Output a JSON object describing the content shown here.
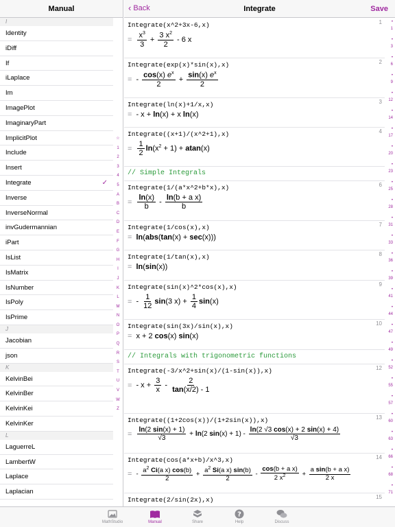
{
  "left": {
    "title": "Manual",
    "rows": [
      {
        "type": "section",
        "label": "I"
      },
      {
        "type": "item",
        "label": "Identity"
      },
      {
        "type": "item",
        "label": "iDiff"
      },
      {
        "type": "item",
        "label": "If"
      },
      {
        "type": "item",
        "label": "iLaplace"
      },
      {
        "type": "item",
        "label": "Im"
      },
      {
        "type": "item",
        "label": "ImagePlot"
      },
      {
        "type": "item",
        "label": "ImaginaryPart"
      },
      {
        "type": "item",
        "label": "ImplicitPlot"
      },
      {
        "type": "item",
        "label": "Include"
      },
      {
        "type": "item",
        "label": "Insert"
      },
      {
        "type": "item",
        "label": "Integrate",
        "selected": true
      },
      {
        "type": "item",
        "label": "Inverse"
      },
      {
        "type": "item",
        "label": "InverseNormal"
      },
      {
        "type": "item",
        "label": "invGudermannian"
      },
      {
        "type": "item",
        "label": "iPart"
      },
      {
        "type": "item",
        "label": "IsList"
      },
      {
        "type": "item",
        "label": "IsMatrix"
      },
      {
        "type": "item",
        "label": "IsNumber"
      },
      {
        "type": "item",
        "label": "IsPoly"
      },
      {
        "type": "item",
        "label": "IsPrime"
      },
      {
        "type": "section",
        "label": "J"
      },
      {
        "type": "item",
        "label": "Jacobian"
      },
      {
        "type": "item",
        "label": "json"
      },
      {
        "type": "section",
        "label": "K"
      },
      {
        "type": "item",
        "label": "KelvinBei"
      },
      {
        "type": "item",
        "label": "KelvinBer"
      },
      {
        "type": "item",
        "label": "KelvinKei"
      },
      {
        "type": "item",
        "label": "KelvinKer"
      },
      {
        "type": "section",
        "label": "L"
      },
      {
        "type": "item",
        "label": "LaguerreL"
      },
      {
        "type": "item",
        "label": "LambertW"
      },
      {
        "type": "item",
        "label": "Laplace"
      },
      {
        "type": "item",
        "label": "Laplacian"
      }
    ],
    "index": [
      "☆",
      "1",
      "2",
      "3",
      "4",
      "5",
      "A",
      "B",
      "C",
      "D",
      "E",
      "F",
      "G",
      "H",
      "I",
      "J",
      "K",
      "L",
      "M",
      "N",
      "O",
      "P",
      "Q",
      "R",
      "S",
      "T",
      "U",
      "V",
      "W",
      "Z"
    ]
  },
  "right": {
    "back_label": "Back",
    "title": "Integrate",
    "save_label": "Save",
    "cells": [
      {
        "num": "1",
        "input": "Integrate(x^2+3x-6,x)"
      },
      {
        "num": "2",
        "input": "Integrate(exp(x)*sin(x),x)"
      },
      {
        "num": "3",
        "input": "Integrate(ln(x)+1/x,x)"
      },
      {
        "num": "4",
        "input": "Integrate((x+1)/(x^2+1),x)"
      },
      {
        "comment": "// Simple Integrals"
      },
      {
        "num": "6",
        "input": "Integrate(1/(a*x^2+b*x),x)"
      },
      {
        "num": "7",
        "input": "Integrate(1/cos(x),x)"
      },
      {
        "num": "8",
        "input": "Integrate(1/tan(x),x)"
      },
      {
        "num": "9",
        "input": "Integrate(sin(x)^2*cos(x),x)"
      },
      {
        "num": "10",
        "input": "Integrate(sin(3x)/sin(x),x)"
      },
      {
        "comment": "// Integrals with trigonometric functions"
      },
      {
        "num": "12",
        "input": "Integrate(-3/x^2+sin(x)/(1-sin(x)),x)"
      },
      {
        "num": "13",
        "input": "Integrate((1+2cos(x))/(1+2sin(x)),x)"
      },
      {
        "num": "14",
        "input": "Integrate(cos(a*x+b)/x^3,x)"
      },
      {
        "num": "15",
        "input": "Integrate(2/sin(2x),x)"
      }
    ],
    "rail": [
      "1",
      "3",
      "6",
      "9",
      "12",
      "14",
      "17",
      "20",
      "23",
      "25",
      "28",
      "31",
      "33",
      "36",
      "39",
      "41",
      "44",
      "47",
      "49",
      "52",
      "55",
      "57",
      "60",
      "63",
      "66",
      "68",
      "71"
    ]
  },
  "tabs": [
    {
      "label": "MathStudio",
      "icon": "image-icon"
    },
    {
      "label": "Manual",
      "icon": "book-icon",
      "active": true
    },
    {
      "label": "Share",
      "icon": "share-icon"
    },
    {
      "label": "Help",
      "icon": "help-icon"
    },
    {
      "label": "Discuss",
      "icon": "chat-icon"
    }
  ],
  "colors": {
    "accent": "#a02aa0",
    "comment": "#2a9a3a",
    "variable": "#1d3fd1",
    "number": "#c8206a"
  }
}
